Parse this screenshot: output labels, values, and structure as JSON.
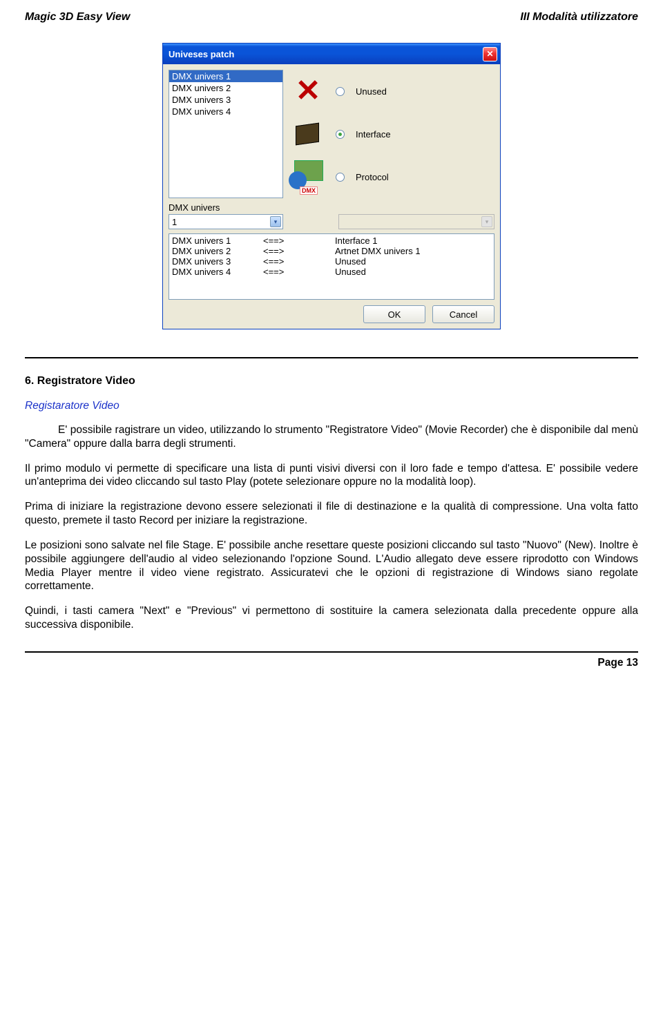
{
  "header": {
    "left": "Magic 3D  Easy View",
    "right": "III Modalità utilizzatore"
  },
  "dialog": {
    "title": "Univeses patch",
    "list": {
      "sel": "DMX univers 1",
      "items": [
        "DMX univers 2",
        "DMX univers 3",
        "DMX univers 4"
      ]
    },
    "options": {
      "unused": "Unused",
      "interface": "Interface",
      "protocol": "Protocol"
    },
    "numlabel": "DMX univers",
    "numvalue": "1",
    "mappings": [
      {
        "a": "DMX univers 1",
        "arr": "<==>",
        "b": "Interface 1"
      },
      {
        "a": "DMX univers 2",
        "arr": "<==>",
        "b": "Artnet DMX univers 1"
      },
      {
        "a": "DMX univers 3",
        "arr": "<==>",
        "b": "Unused"
      },
      {
        "a": "DMX univers 4",
        "arr": "<==>",
        "b": "Unused"
      }
    ],
    "ok": "OK",
    "cancel": "Cancel",
    "dmxiconlabel": "DMX"
  },
  "section": {
    "heading": "6. Registratore Video",
    "subhead": "Registaratore Video",
    "p1": "E' possibile ragistrare un video, utilizzando lo strumento \"Registratore Video\" (Movie Recorder) che è disponibile dal menù \"Camera\" oppure dalla barra degli strumenti.",
    "p2": "Il primo modulo vi permette di specificare una lista di punti visivi diversi  con il loro fade e tempo d'attesa. E' possibile vedere un'anteprima dei video cliccando sul tasto Play (potete selezionare oppure no la modalità loop).",
    "p3": "Prima di iniziare la registrazione devono essere selezionati il file di destinazione e la qualità di compressione. Una volta fatto questo, premete il tasto Record per iniziare la registrazione.",
    "p4": "Le posizioni sono salvate nel file Stage. E' possibile anche resettare queste posizioni cliccando sul tasto \"Nuovo\" (New). Inoltre è possibile aggiungere dell'audio al video selezionando l'opzione Sound. L'Audio allegato deve essere riprodotto con Windows Media Player mentre il video viene registrato. Assicuratevi che le opzioni di registrazione di Windows siano regolate correttamente.",
    "p5": "Quindi, i tasti camera \"Next\" e \"Previous\" vi permettono di sostituire la camera selezionata dalla precedente oppure alla successiva disponibile."
  },
  "footer": {
    "page": "Page 13"
  }
}
